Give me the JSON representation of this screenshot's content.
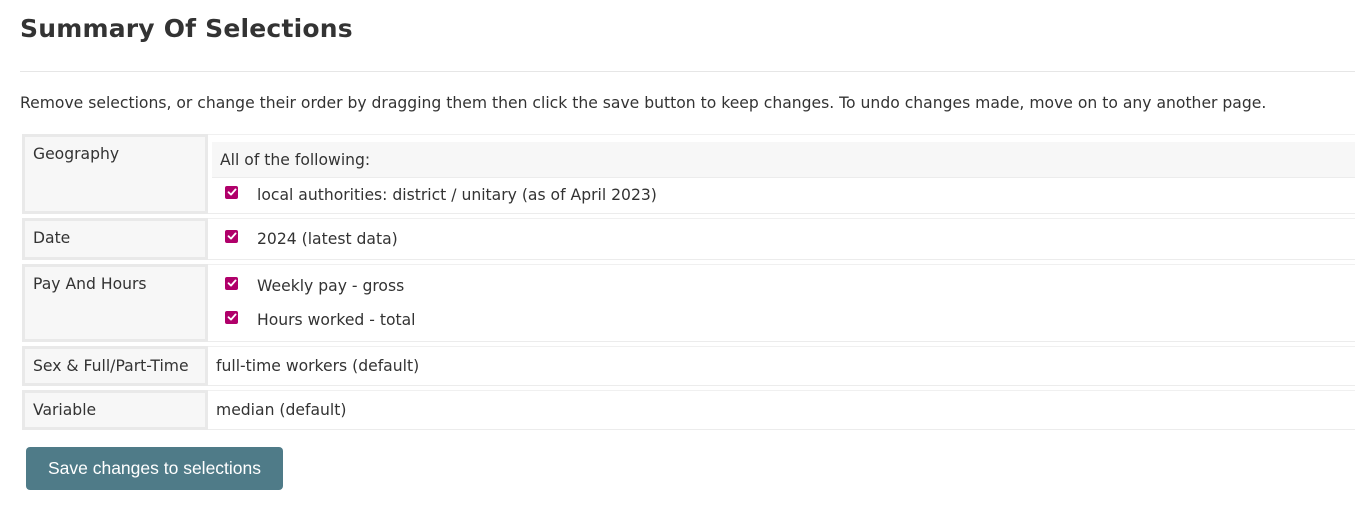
{
  "page": {
    "title": "Summary Of Selections",
    "intro": "Remove selections, or change their order by dragging them then click the save button to keep changes. To undo changes made, move on to any another page."
  },
  "rows": {
    "geography": {
      "label": "Geography",
      "group_head": "All of the following:",
      "items": [
        "local authorities: district / unitary (as of April 2023)"
      ]
    },
    "date": {
      "label": "Date",
      "items": [
        "2024 (latest data)"
      ]
    },
    "pay": {
      "label": "Pay And Hours",
      "items": [
        "Weekly pay - gross",
        "Hours worked - total"
      ]
    },
    "sex": {
      "label": "Sex & Full/Part-Time",
      "value": "full-time workers (default)"
    },
    "variable": {
      "label": "Variable",
      "value": "median (default)"
    }
  },
  "actions": {
    "save_label": "Save changes to selections"
  },
  "colors": {
    "checkbox": "#b0006a",
    "button": "#4f7b88"
  }
}
